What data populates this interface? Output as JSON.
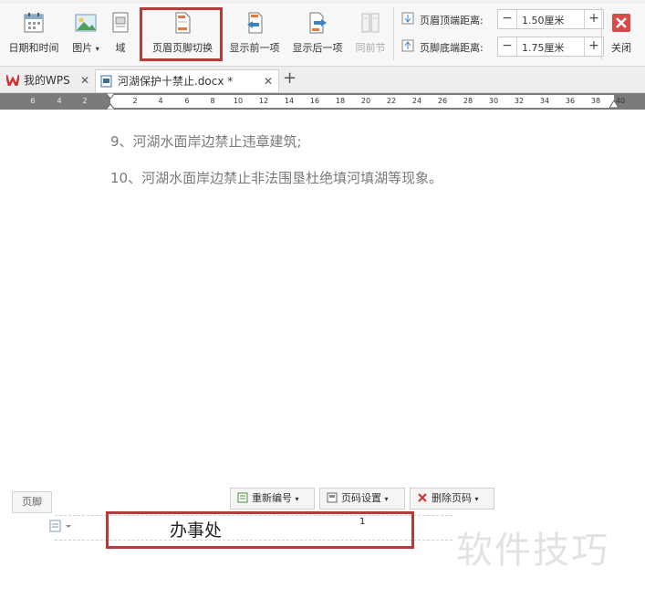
{
  "toolbar": {
    "date_time": "日期和时间",
    "picture": "图片",
    "field": "域",
    "switch_header_footer": "页眉页脚切换",
    "show_previous": "显示前一项",
    "show_next": "显示后一项",
    "same_as_previous": "同前节",
    "header_top_distance": {
      "label": "页眉顶端距离:",
      "value": "1.50厘米"
    },
    "footer_bottom_distance": {
      "label": "页脚底端距离:",
      "value": "1.75厘米"
    },
    "close": "关闭",
    "stepper_minus": "−",
    "stepper_plus": "+"
  },
  "tabs": [
    {
      "label": "我的WPS",
      "active": false
    },
    {
      "label": "河湖保护十禁止.docx *",
      "active": true
    }
  ],
  "ruler_ticks": [
    "6",
    "4",
    "2",
    "2",
    "4",
    "6",
    "8",
    "10",
    "12",
    "14",
    "16",
    "18",
    "20",
    "22",
    "24",
    "26",
    "28",
    "30",
    "32",
    "34",
    "36",
    "38",
    "40"
  ],
  "document": {
    "paragraphs": [
      "9、河湖水面岸边禁止违章建筑;",
      "10、河湖水面岸边禁止非法围垦杜绝填河填湖等现象。"
    ],
    "footer_tag": "页脚",
    "renumber": "重新编号",
    "page_number_settings": "页码设置",
    "delete_page_number": "删除页码",
    "footer_text": "办事处",
    "page_number": "1"
  },
  "watermark": "软件技巧",
  "colors": {
    "highlight": "#b73a3a",
    "wps_red": "#d0312d",
    "close_red": "#d84a4a"
  }
}
